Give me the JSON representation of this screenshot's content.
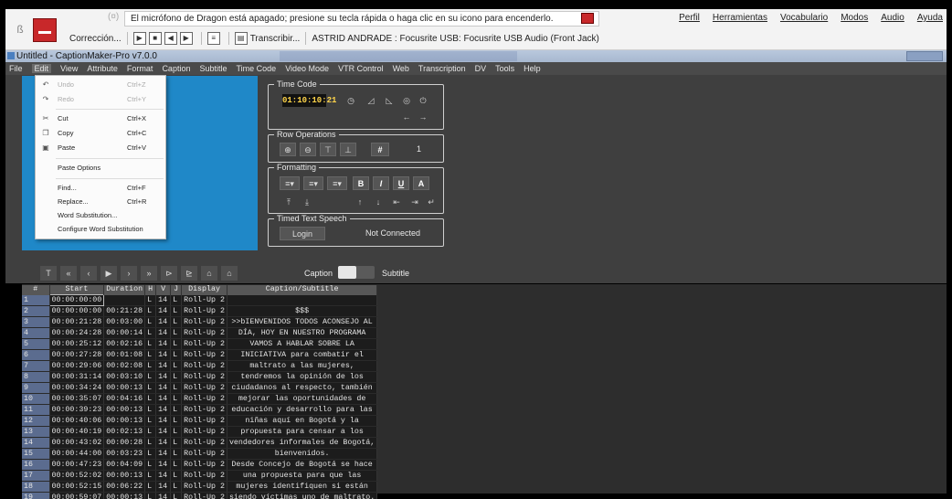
{
  "dragon": {
    "mic_label": "(¤)",
    "message": "El micrófono de Dragon está apagado; presione su tecla rápida o haga clic en su icono para encenderlo.",
    "menu": [
      "Perfil",
      "Herramientas",
      "Vocabulario",
      "Modos",
      "Audio",
      "Ayuda"
    ],
    "correction_label": "Corrección...",
    "transcribe_label": "Transcribir...",
    "mic_source": "ASTRID ANDRADE : Focusrite USB: Focusrite USB Audio (Front Jack)"
  },
  "window": {
    "title": "Untitled - CaptionMaker-Pro v7.0.0"
  },
  "menubar": [
    "File",
    "Edit",
    "View",
    "Attribute",
    "Format",
    "Caption",
    "Subtitle",
    "Time Code",
    "Video Mode",
    "VTR Control",
    "Web",
    "Transcription",
    "DV",
    "Tools",
    "Help"
  ],
  "edit_menu": {
    "undo": "Undo",
    "undo_sc": "Ctrl+Z",
    "redo": "Redo",
    "redo_sc": "Ctrl+Y",
    "cut": "Cut",
    "cut_sc": "Ctrl+X",
    "copy": "Copy",
    "copy_sc": "Ctrl+C",
    "paste": "Paste",
    "paste_sc": "Ctrl+V",
    "paste_options": "Paste Options",
    "find": "Find...",
    "find_sc": "Ctrl+F",
    "replace": "Replace...",
    "replace_sc": "Ctrl+R",
    "word_sub": "Word Substitution...",
    "config_word_sub": "Configure Word Substitution"
  },
  "timecode": {
    "title": "Time Code",
    "value": "01:10:10:21"
  },
  "row_ops": {
    "title": "Row Operations",
    "hash": "#",
    "value": "1"
  },
  "formatting": {
    "title": "Formatting",
    "bold": "B",
    "italic": "I",
    "underline": "U",
    "font_a": "A"
  },
  "tts": {
    "title": "Timed Text Speech",
    "login": "Login",
    "status": "Not Connected"
  },
  "toggle": {
    "caption": "Caption",
    "subtitle": "Subtitle"
  },
  "table": {
    "headers": [
      "#",
      "Start",
      "Duration",
      "H",
      "V",
      "J",
      "Display",
      "Caption/Subtitle"
    ],
    "rows": [
      [
        "1",
        "00:00:00:00",
        "",
        "L",
        "14",
        "L",
        "Roll-Up 2",
        ""
      ],
      [
        "2",
        "00:00:00:00",
        "00:21:28",
        "L",
        "14",
        "L",
        "Roll-Up 2",
        "$$$"
      ],
      [
        "3",
        "00:00:21:28",
        "00:03:00",
        "L",
        "14",
        "L",
        "Roll-Up 2",
        ">>bIENVENIDOS TODOS ACONSEJO AL"
      ],
      [
        "4",
        "00:00:24:28",
        "00:00:14",
        "L",
        "14",
        "L",
        "Roll-Up 2",
        "DÍA, HOY EN NUESTRO PROGRAMA"
      ],
      [
        "5",
        "00:00:25:12",
        "00:02:16",
        "L",
        "14",
        "L",
        "Roll-Up 2",
        "VAMOS A HABLAR SOBRE LA"
      ],
      [
        "6",
        "00:00:27:28",
        "00:01:08",
        "L",
        "14",
        "L",
        "Roll-Up 2",
        "INICIATIVA para combatir el"
      ],
      [
        "7",
        "00:00:29:06",
        "00:02:08",
        "L",
        "14",
        "L",
        "Roll-Up 2",
        "maltrato a las mujeres,"
      ],
      [
        "8",
        "00:00:31:14",
        "00:03:10",
        "L",
        "14",
        "L",
        "Roll-Up 2",
        "tendremos la opinión de los"
      ],
      [
        "9",
        "00:00:34:24",
        "00:00:13",
        "L",
        "14",
        "L",
        "Roll-Up 2",
        "ciudadanos al respecto, también"
      ],
      [
        "10",
        "00:00:35:07",
        "00:04:16",
        "L",
        "14",
        "L",
        "Roll-Up 2",
        "mejorar las oportunidades de"
      ],
      [
        "11",
        "00:00:39:23",
        "00:00:13",
        "L",
        "14",
        "L",
        "Roll-Up 2",
        "educación y desarrollo para las"
      ],
      [
        "12",
        "00:00:40:06",
        "00:00:13",
        "L",
        "14",
        "L",
        "Roll-Up 2",
        "niñas aquí en Bogotá y la"
      ],
      [
        "13",
        "00:00:40:19",
        "00:02:13",
        "L",
        "14",
        "L",
        "Roll-Up 2",
        "propuesta para censar a los"
      ],
      [
        "14",
        "00:00:43:02",
        "00:00:28",
        "L",
        "14",
        "L",
        "Roll-Up 2",
        "vendedores informales de Bogotá,"
      ],
      [
        "15",
        "00:00:44:00",
        "00:03:23",
        "L",
        "14",
        "L",
        "Roll-Up 2",
        "bienvenidos."
      ],
      [
        "16",
        "00:00:47:23",
        "00:04:09",
        "L",
        "14",
        "L",
        "Roll-Up 2",
        "Desde Concejo de Bogotá se hace"
      ],
      [
        "17",
        "00:00:52:02",
        "00:00:13",
        "L",
        "14",
        "L",
        "Roll-Up 2",
        "una propuesta para que las"
      ],
      [
        "18",
        "00:00:52:15",
        "00:06:22",
        "L",
        "14",
        "L",
        "Roll-Up 2",
        "mujeres identifiquen si están"
      ],
      [
        "19",
        "00:00:59:07",
        "00:00:13",
        "L",
        "14",
        "L",
        "Roll-Up 2",
        "siendo víctimas uno de maltrato."
      ]
    ]
  }
}
